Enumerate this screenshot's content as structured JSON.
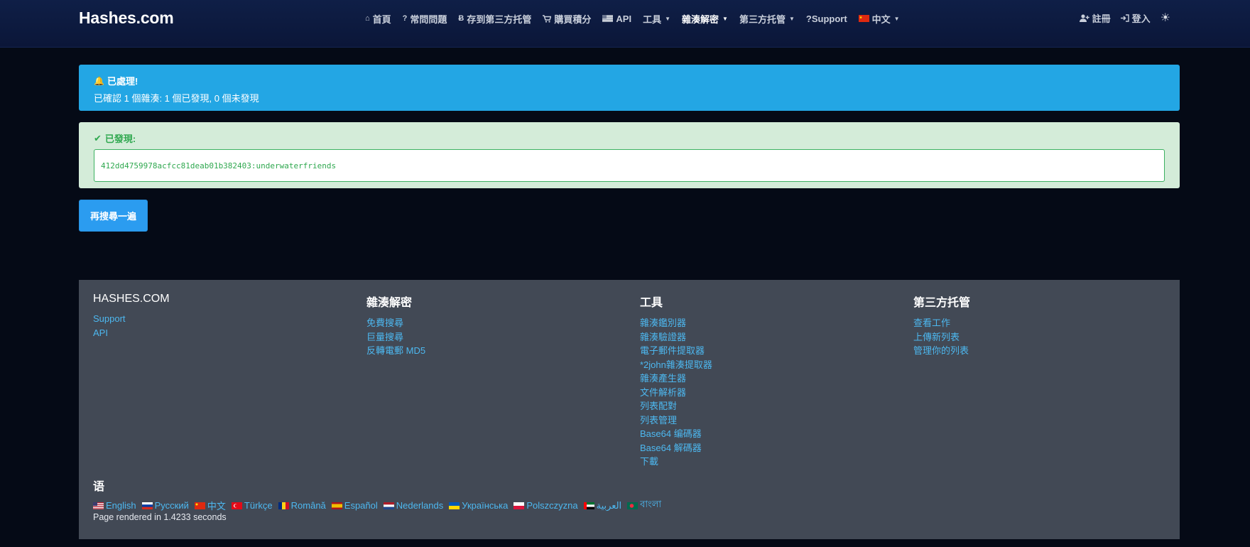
{
  "nav": {
    "brand": "Hashes.com",
    "items": [
      {
        "icon": "home-icon",
        "glyph": "⌂",
        "label": "首頁"
      },
      {
        "icon": "question-icon",
        "glyph": "?",
        "label": "常問問題"
      },
      {
        "icon": "bitcoin-icon",
        "glyph": "Ƀ",
        "label": "存到第三方托管"
      },
      {
        "icon": "cart-icon",
        "glyph": "🛒",
        "label": "購買積分"
      },
      {
        "icon": "us-flag-icon",
        "glyph": "",
        "label": "API"
      },
      {
        "icon": "",
        "glyph": "",
        "label": "工具",
        "dropdown": true
      },
      {
        "icon": "",
        "glyph": "",
        "label": "雜湊解密",
        "dropdown": true,
        "active": true
      },
      {
        "icon": "",
        "glyph": "",
        "label": "第三方托管",
        "dropdown": true
      },
      {
        "icon": "",
        "glyph": "",
        "label": "?Support"
      },
      {
        "icon": "china-flag-icon",
        "glyph": "",
        "label": "中文",
        "dropdown": true
      }
    ],
    "register": "註冊",
    "login": "登入"
  },
  "alert_info": {
    "title": "已處理!",
    "text": "已確認 1 個雜湊: 1 個已發現, 0 個未發現"
  },
  "alert_success": {
    "title": "已發現:",
    "result": "412dd4759978acfcc81deab01b382403:underwaterfriends"
  },
  "search_again_button": "再搜尋一遍",
  "footer": {
    "columns": [
      {
        "title": "HASHES.COM",
        "links": [
          "Support",
          "API"
        ]
      },
      {
        "title": "雜湊解密",
        "links": [
          "免費搜尋",
          "巨量搜尋",
          "反轉電郵 MD5"
        ]
      },
      {
        "title": "工具",
        "links": [
          "雜湊鑑別器",
          "雜湊驗證器",
          "電子郵件提取器",
          "*2john雜湊提取器",
          "雜湊產生器",
          "文件解析器",
          "列表配對",
          "列表管理",
          "Base64 编碼器",
          "Base64 解碼器",
          "下載"
        ]
      },
      {
        "title": "第三方托管",
        "links": [
          "查看工作",
          "上傳新列表",
          "管理你的列表"
        ]
      }
    ],
    "languages_title": "语",
    "languages": [
      {
        "flag": "us",
        "label": "English"
      },
      {
        "flag": "ru",
        "label": "Русский"
      },
      {
        "flag": "cn",
        "label": "中文"
      },
      {
        "flag": "tr",
        "label": "Türkçe"
      },
      {
        "flag": "ro",
        "label": "Română"
      },
      {
        "flag": "es",
        "label": "Español"
      },
      {
        "flag": "nl",
        "label": "Nederlands"
      },
      {
        "flag": "ua",
        "label": "Українська"
      },
      {
        "flag": "pl",
        "label": "Polszczyzna"
      },
      {
        "flag": "ae",
        "label": "العربية"
      },
      {
        "flag": "bd",
        "label": "বাংলা"
      }
    ],
    "rendered": "Page rendered in 1.4233 seconds"
  },
  "colors": {
    "info": "#23a6e4",
    "success_bg": "#d4ecd9",
    "success_text": "#2fa84f",
    "button": "#2b9cf0",
    "link": "#4db8f0",
    "footer_bg": "#424955"
  }
}
